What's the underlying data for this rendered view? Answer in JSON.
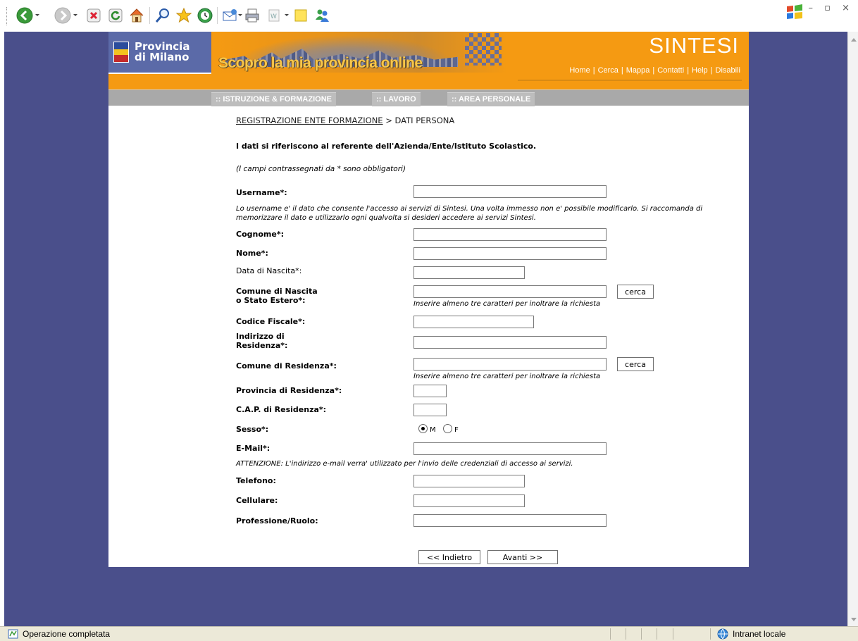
{
  "browser": {
    "toolbar_icons": [
      "back-icon",
      "forward-icon",
      "stop-icon",
      "refresh-icon",
      "home-icon",
      "search-icon",
      "favorites-icon",
      "history-icon",
      "mail-icon",
      "print-icon",
      "edit-icon",
      "notes-icon",
      "messenger-icon"
    ],
    "window_controls": "– ▫ ×",
    "status": "Operazione completata",
    "zone": "Intranet locale"
  },
  "header": {
    "logo_line1": "Provincia",
    "logo_line2": "di Milano",
    "banner_title": "Scopro la mia provincia online",
    "brand": "SINTESI",
    "links": [
      "Home",
      "Cerca",
      "Mappa",
      "Contatti",
      "Help",
      "Disabili"
    ]
  },
  "nav": {
    "tabs": [
      ":: ISTRUZIONE & FORMAZIONE",
      ":: LAVORO",
      ":: AREA PERSONALE"
    ]
  },
  "breadcrumb": {
    "link": "REGISTRAZIONE ENTE FORMAZIONE",
    "rest": " > DATI PERSONA"
  },
  "form": {
    "intro": "I dati si riferiscono al referente dell'Azienda/Ente/Istituto Scolastico.",
    "required_note": "(I campi contrassegnati da * sono obbligatori)",
    "username_label": "Username*:",
    "username_help": "Lo username e' il dato che consente l'accesso ai servizi di Sintesi. Una volta immesso non e' possibile modificarlo. Si raccomanda di memorizzare il dato e utilizzarlo ogni qualvolta si desideri accedere ai servizi Sintesi.",
    "cognome_label": "Cognome*:",
    "nome_label": "Nome*:",
    "data_nascita_label": "Data di Nascita*:",
    "comune_nascita_label_1": "Comune di Nascita",
    "comune_nascita_label_2": "o Stato Estero*:",
    "search_help": "Inserire almeno tre caratteri per inoltrare la richiesta",
    "cerca_label": "cerca",
    "codice_fiscale_label": "Codice Fiscale*:",
    "indirizzo_label_1": "Indirizzo di",
    "indirizzo_label_2": "Residenza*:",
    "comune_residenza_label": "Comune di Residenza*:",
    "provincia_label": "Provincia di Residenza*:",
    "cap_label": "C.A.P. di Residenza*:",
    "sesso_label": "Sesso*:",
    "sesso_options": [
      "M",
      "F"
    ],
    "sesso_selected": "M",
    "email_label": "E-Mail*:",
    "email_warning": "ATTENZIONE: L'indirizzo e-mail verra' utilizzato per l'invio delle credenziali di accesso ai servizi.",
    "telefono_label": "Telefono:",
    "cellulare_label": "Cellulare:",
    "professione_label": "Professione/Ruolo:",
    "back_label": "<< Indietro",
    "next_label": "Avanti >>"
  },
  "colors": {
    "header_orange": "#f59a12",
    "page_background": "#4a4f8b",
    "nav_gray": "#a9a9a9"
  }
}
